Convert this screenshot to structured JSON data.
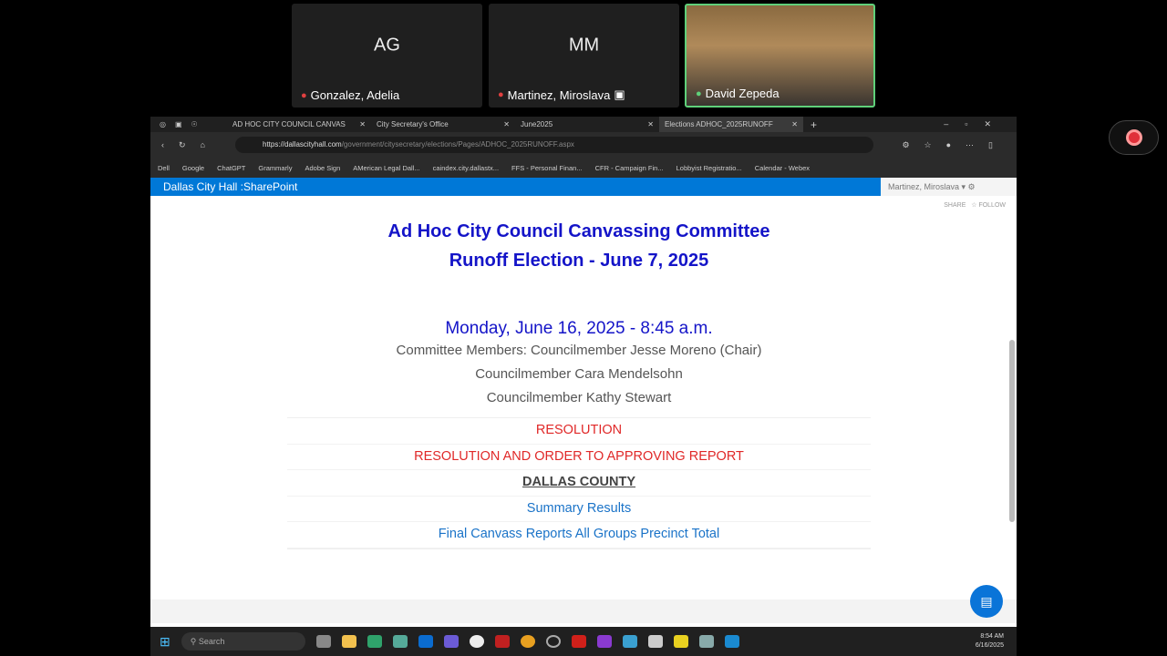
{
  "participants": [
    {
      "initials": "AG",
      "name": "Gonzalez, Adelia"
    },
    {
      "initials": "MM",
      "name": "Martinez, Miroslava"
    },
    {
      "name": "David Zepeda"
    }
  ],
  "browser": {
    "tabs": [
      "AD HOC CITY COUNCIL CANVAS",
      "City Secretary's Office",
      "June2025",
      "Elections ADHOC_2025RUNOFF"
    ],
    "url_domain": "https://dallascityhall.com",
    "url_path": "/government/citysecretary/elections/Pages/ADHOC_2025RUNOFF.aspx",
    "bookmarks": [
      "Dell",
      "Google",
      "ChatGPT",
      "Grammarly",
      "Adobe Sign",
      "AMerican Legal Dall...",
      "caindex.city.dallastx...",
      "FFS - Personal Finan...",
      "CFR - Campaign Fin...",
      "Lobbyist Registratio...",
      "Calendar - Webex"
    ]
  },
  "sharepoint": {
    "title": "Dallas City Hall :SharePoint",
    "user": "Martinez, Miroslava",
    "share": "SHARE",
    "follow": "FOLLOW"
  },
  "page": {
    "title1": "Ad Hoc City Council Canvassing Committee",
    "title2": "Runoff Election - June 7, 2025",
    "date": "Monday, June 16, 2025 - 8:45 a.m.",
    "members": [
      "Committee Members: Councilmember Jesse Moreno (Chair)",
      "Councilmember Cara Mendelsohn",
      "Councilmember Kathy Stewart"
    ],
    "links": [
      "RESOLUTION",
      "RESOLUTION AND ORDER TO APPROVING REPORT",
      "DALLAS COUNTY",
      "Summary Results",
      "Final Canvass Reports All Groups Precinct Total"
    ]
  },
  "taskbar": {
    "search": "Search",
    "time": "8:54 AM",
    "date": "6/16/2025"
  }
}
